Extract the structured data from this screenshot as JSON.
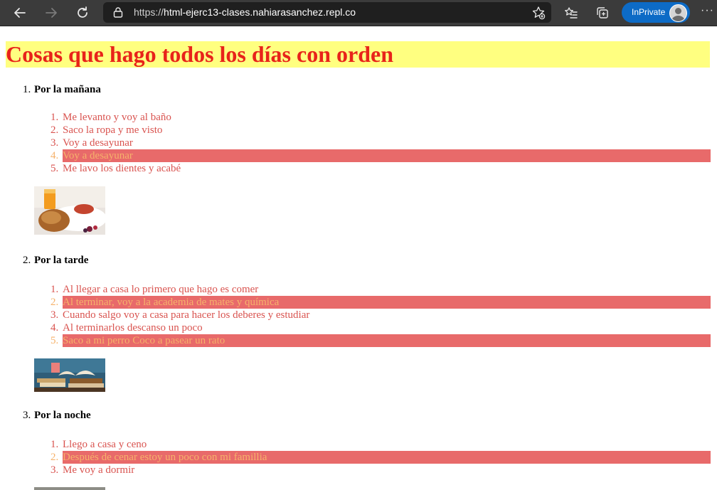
{
  "browser": {
    "url_prefix": "https://",
    "url_host": "html-ejerc13-clases.nahiarasanchez.repl.co",
    "inprivate_label": "InPrivate"
  },
  "page": {
    "title": "Cosas que hago todos los días con orden",
    "sections": [
      {
        "number": "1.",
        "title": "Por la mañana",
        "items": [
          {
            "n": "1.",
            "text": "Me levanto y voy al baño"
          },
          {
            "n": "2.",
            "text": "Saco la ropa y me visto"
          },
          {
            "n": "3.",
            "text": "Voy a desayunar"
          },
          {
            "n": "4.",
            "text": "Voy a desayunar"
          },
          {
            "n": "5.",
            "text": "Me lavo los dientes y acabé"
          }
        ]
      },
      {
        "number": "2.",
        "title": "Por la tarde",
        "items": [
          {
            "n": "1.",
            "text": "Al llegar a casa lo primero que hago es comer"
          },
          {
            "n": "2.",
            "text": "Al terminar, voy a la academia de mates y química"
          },
          {
            "n": "3.",
            "text": "Cuando salgo voy a casa para hacer los deberes y estudiar"
          },
          {
            "n": "4.",
            "text": "Al terminarlos descanso un poco"
          },
          {
            "n": "5.",
            "text": "Saco a mi perro Coco a pasear un rato"
          }
        ]
      },
      {
        "number": "3.",
        "title": "Por la noche",
        "items": [
          {
            "n": "1.",
            "text": "Llego a casa y ceno"
          },
          {
            "n": "2.",
            "text": "Después de cenar estoy un poco con mi famillia"
          },
          {
            "n": "3.",
            "text": "Me voy a dormir"
          }
        ]
      }
    ]
  },
  "colors": {
    "title_text": "#e8231a",
    "title_bg": "#ffff80",
    "item_text": "#d9534f",
    "highlight_bg": "#e86a6a",
    "highlight_text": "#f6b26b"
  }
}
